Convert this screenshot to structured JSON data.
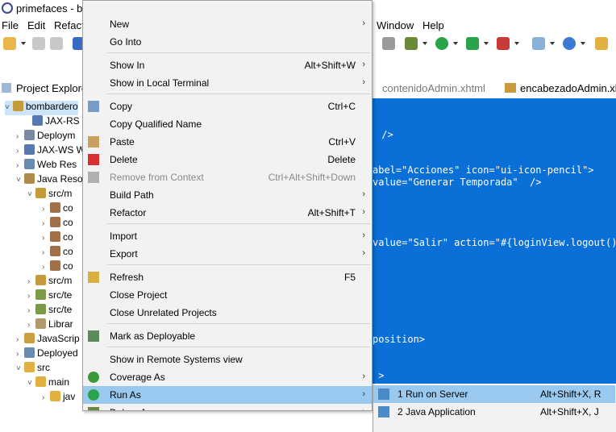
{
  "window": {
    "title": "primefaces - bo"
  },
  "menubar": {
    "items": [
      "File",
      "Edit",
      "Refact",
      "Window",
      "Help"
    ]
  },
  "view_tabs": {
    "project_explorer": "Project Explore",
    "editor_tab_1": "contenidoAdmin.xhtml",
    "editor_tab_2": "encabezadoAdmin.xht"
  },
  "tree": {
    "nodes": [
      {
        "label": "bombardero",
        "arrow": "˅"
      },
      {
        "label": "JAX-RS W",
        "arrow": ""
      },
      {
        "label": "Deploym",
        "arrow": "›"
      },
      {
        "label": "JAX-WS W",
        "arrow": "›"
      },
      {
        "label": "Web Res",
        "arrow": "›"
      },
      {
        "label": "Java Reso",
        "arrow": "˅"
      },
      {
        "label": "src/m",
        "arrow": "˅"
      },
      {
        "label": "co",
        "arrow": "›"
      },
      {
        "label": "co",
        "arrow": "›"
      },
      {
        "label": "co",
        "arrow": "›"
      },
      {
        "label": "co",
        "arrow": "›"
      },
      {
        "label": "co",
        "arrow": "›"
      },
      {
        "label": "src/m",
        "arrow": "›"
      },
      {
        "label": "src/te",
        "arrow": "›"
      },
      {
        "label": "src/te",
        "arrow": "›"
      },
      {
        "label": "Librar",
        "arrow": "›"
      },
      {
        "label": "JavaScrip",
        "arrow": "›"
      },
      {
        "label": "Deployed",
        "arrow": "›"
      },
      {
        "label": "src",
        "arrow": "˅"
      },
      {
        "label": "main",
        "arrow": "˅"
      },
      {
        "label": "jav",
        "arrow": "›"
      }
    ]
  },
  "editor": {
    "lines": [
      {
        "text": " />"
      },
      {
        "text": "abel=\"Acciones\" icon=\"ui-icon-pencil\">"
      },
      {
        "text": "value=\"Generar Temporada\"  />"
      },
      {
        "text": "value=\"Salir\" action=\"#{loginView.logout()}"
      },
      {
        "text": "position>"
      },
      {
        "text": " >"
      }
    ]
  },
  "context_menu": {
    "items": [
      {
        "label": "New",
        "shortcut": "",
        "submenu": "›",
        "icon": "none"
      },
      {
        "label": "Go Into",
        "shortcut": "",
        "submenu": "",
        "icon": "none"
      },
      {
        "label": "Show In",
        "shortcut": "Alt+Shift+W",
        "submenu": "›",
        "icon": "none"
      },
      {
        "label": "Show in Local Terminal",
        "shortcut": "",
        "submenu": "›",
        "icon": "none"
      },
      {
        "label": "Copy",
        "shortcut": "Ctrl+C",
        "submenu": "",
        "icon": "copy-icon"
      },
      {
        "label": "Copy Qualified Name",
        "shortcut": "",
        "submenu": "",
        "icon": "none"
      },
      {
        "label": "Paste",
        "shortcut": "Ctrl+V",
        "submenu": "",
        "icon": "paste-icon"
      },
      {
        "label": "Delete",
        "shortcut": "Delete",
        "submenu": "",
        "icon": "delete-icon"
      },
      {
        "label": "Remove from Context",
        "shortcut": "Ctrl+Alt+Shift+Down",
        "submenu": "",
        "icon": "remove-context-icon",
        "disabled": true
      },
      {
        "label": "Build Path",
        "shortcut": "",
        "submenu": "›",
        "icon": "none"
      },
      {
        "label": "Refactor",
        "shortcut": "Alt+Shift+T",
        "submenu": "›",
        "icon": "none"
      },
      {
        "label": "Import",
        "shortcut": "",
        "submenu": "›",
        "icon": "none"
      },
      {
        "label": "Export",
        "shortcut": "",
        "submenu": "›",
        "icon": "none"
      },
      {
        "label": "Refresh",
        "shortcut": "F5",
        "submenu": "",
        "icon": "refresh-icon"
      },
      {
        "label": "Close Project",
        "shortcut": "",
        "submenu": "",
        "icon": "none"
      },
      {
        "label": "Close Unrelated Projects",
        "shortcut": "",
        "submenu": "",
        "icon": "none"
      },
      {
        "label": "Mark as Deployable",
        "shortcut": "",
        "submenu": "",
        "icon": "deployable-icon"
      },
      {
        "label": "Show in Remote Systems view",
        "shortcut": "",
        "submenu": "",
        "icon": "none"
      },
      {
        "label": "Coverage As",
        "shortcut": "",
        "submenu": "›",
        "icon": "coverage-icon"
      },
      {
        "label": "Run As",
        "shortcut": "",
        "submenu": "›",
        "icon": "run-icon",
        "highlighted": true
      },
      {
        "label": "Debug As",
        "shortcut": "",
        "submenu": "›",
        "icon": "debug-icon"
      }
    ]
  },
  "submenu": {
    "items": [
      {
        "label": "1 Run on Server",
        "shortcut": "Alt+Shift+X, R",
        "highlighted": true
      },
      {
        "label": "2 Java Application",
        "shortcut": "Alt+Shift+X, J"
      }
    ]
  },
  "colors": {
    "editor_bg": "#0a6fd6",
    "highlight": "#99c9ef",
    "menu_bg": "#f2f2f2"
  }
}
